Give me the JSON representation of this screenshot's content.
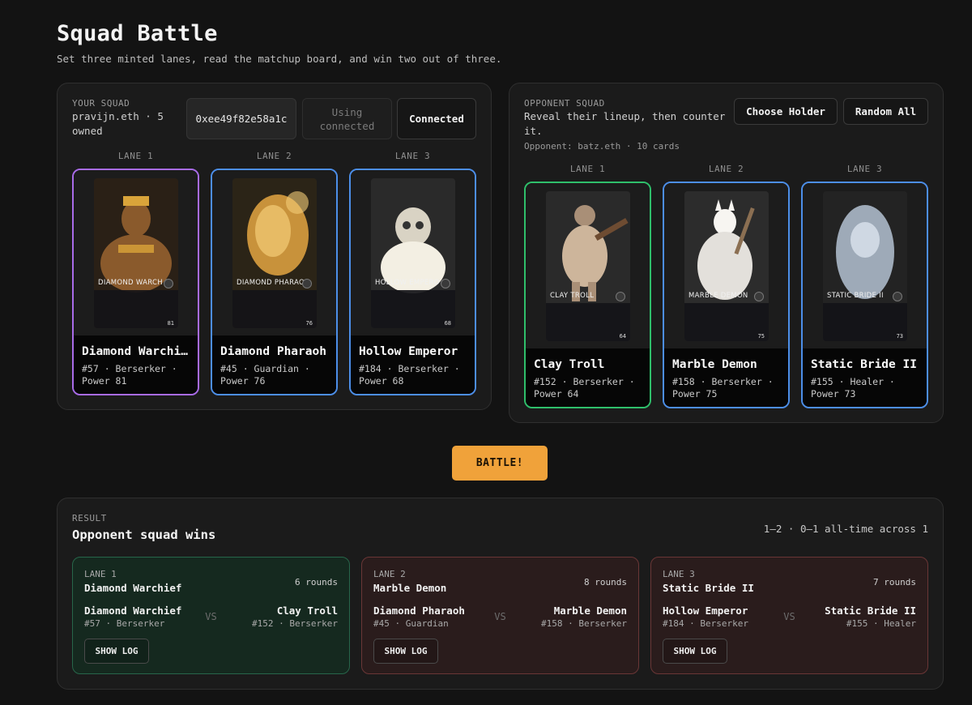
{
  "header": {
    "title": "Squad Battle",
    "subtitle": "Set three minted lanes, read the matchup board, and win two out of three."
  },
  "your_squad": {
    "kicker": "YOUR SQUAD",
    "owner_line1": "pravijn.eth · 5",
    "owner_line2": "owned",
    "address": "0xee49f82e58a1c",
    "using_line1": "Using",
    "using_line2": "connected",
    "connected_label": "Connected",
    "lanes": [
      {
        "lane": "LANE 1",
        "name": "Diamond Warchi…",
        "art_name": "DIAMOND WARCH F",
        "meta1": "#57 · Berserker ·",
        "meta2": "Power 81",
        "power": "81",
        "color": "purple"
      },
      {
        "lane": "LANE 2",
        "name": "Diamond Pharaoh",
        "art_name": "DIAMOND PHARAO",
        "meta1": "#45 · Guardian ·",
        "meta2": "Power 76",
        "power": "76",
        "color": "blue"
      },
      {
        "lane": "LANE 3",
        "name": "Hollow Emperor",
        "art_name": "HOLLOW EMPERO",
        "meta1": "#184 · Berserker ·",
        "meta2": "Power 68",
        "power": "68",
        "color": "blue"
      }
    ]
  },
  "opponent_squad": {
    "kicker": "OPPONENT SQUAD",
    "desc_line1": "Reveal their lineup, then counter",
    "desc_line2": "it.",
    "opponent_line": "Opponent: batz.eth · 10 cards",
    "choose_holder_label": "Choose Holder",
    "random_all_label": "Random All",
    "lanes": [
      {
        "lane": "LANE 1",
        "name": "Clay Troll",
        "art_name": "CLAY TROLL",
        "meta1": "#152 · Berserker ·",
        "meta2": "Power 64",
        "power": "64",
        "color": "green"
      },
      {
        "lane": "LANE 2",
        "name": "Marble Demon",
        "art_name": "MARBLE DEMON",
        "meta1": "#158 · Berserker ·",
        "meta2": "Power 75",
        "power": "75",
        "color": "blue"
      },
      {
        "lane": "LANE 3",
        "name": "Static Bride II",
        "art_name": "STATIC BRIDE II",
        "meta1": "#155 · Healer ·",
        "meta2": "Power 73",
        "power": "73",
        "color": "blue"
      }
    ]
  },
  "battle_label": "BATTLE!",
  "result": {
    "kicker": "RESULT",
    "title": "Opponent squad wins",
    "summary": "1–2 · 0–1 all-time across 1",
    "lanes": [
      {
        "kicker": "LANE 1",
        "winner": "Diamond Warchief",
        "rounds": "6 rounds",
        "outcome": "win",
        "left_name": "Diamond Warchief",
        "left_meta": "#57 · Berserker",
        "right_name": "Clay Troll",
        "right_meta": "#152 · Berserker",
        "vs": "VS",
        "log_label": "SHOW LOG"
      },
      {
        "kicker": "LANE 2",
        "winner": "Marble Demon",
        "rounds": "8 rounds",
        "outcome": "loss",
        "left_name": "Diamond Pharaoh",
        "left_meta": "#45 · Guardian",
        "right_name": "Marble Demon",
        "right_meta": "#158 · Berserker",
        "vs": "VS",
        "log_label": "SHOW LOG"
      },
      {
        "kicker": "LANE 3",
        "winner": "Static Bride II",
        "rounds": "7 rounds",
        "outcome": "loss",
        "left_name": "Hollow Emperor",
        "left_meta": "#184 · Berserker",
        "right_name": "Static Bride II",
        "right_meta": "#155 · Healer",
        "vs": "VS",
        "log_label": "SHOW LOG"
      }
    ]
  },
  "colors": {
    "accent": "#f0a23a",
    "card_border_blue": "#4c8ee8",
    "card_border_purple": "#a86be8",
    "card_border_green": "#2fbf6b",
    "win_bg": "#15291f",
    "loss_bg": "#2a1c1c"
  }
}
